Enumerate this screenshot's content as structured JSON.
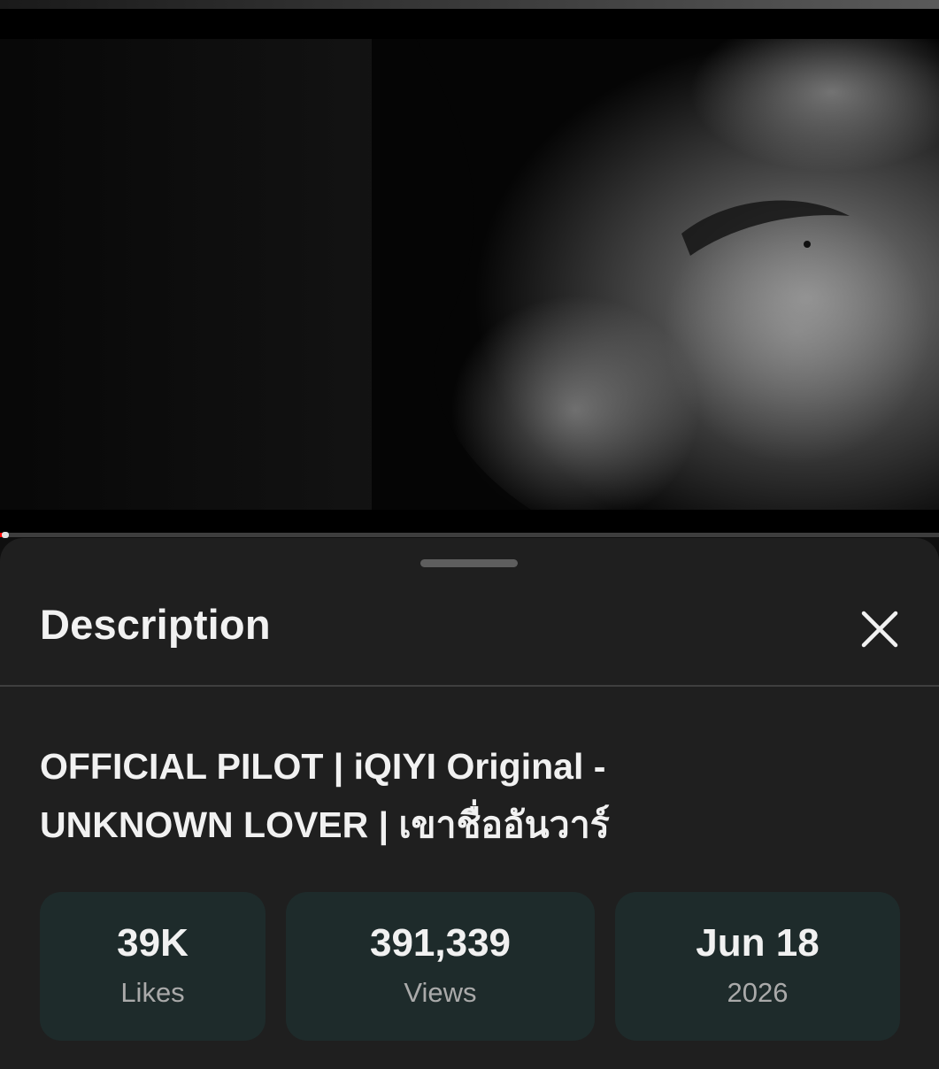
{
  "video": {
    "description": "Black-and-white close-up video frame",
    "progress_fraction": 0.004
  },
  "sheet": {
    "title": "Description",
    "close_icon": "close-icon",
    "video_title_line1": "OFFICIAL PILOT | iQIYI Original -",
    "video_title_line2": "UNKNOWN LOVER | เขาชื่ออันวาร์"
  },
  "stats": [
    {
      "value": "39K",
      "label": "Likes"
    },
    {
      "value": "391,339",
      "label": "Views"
    },
    {
      "value": "Jun 18",
      "label": "2026"
    }
  ],
  "colors": {
    "background": "#0f0f0f",
    "sheet": "#1f1f1f",
    "stat_card": "#1e2b2b",
    "progress": "#ff0000"
  }
}
